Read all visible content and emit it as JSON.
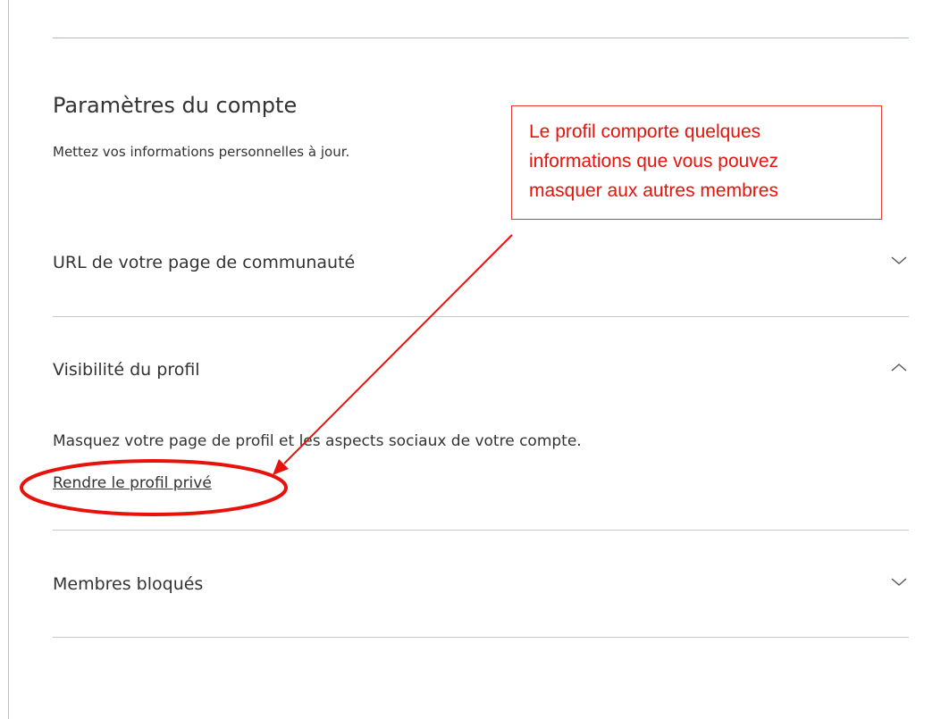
{
  "account_settings": {
    "title": "Paramètres du compte",
    "subtitle": "Mettez vos informations personnelles à jour."
  },
  "sections": {
    "community_url": {
      "label": "URL de votre page de communauté",
      "expanded": false,
      "chevron_icon": "chevron-down-icon"
    },
    "profile_visibility": {
      "label": "Visibilité du profil",
      "expanded": true,
      "chevron_icon": "chevron-up-icon",
      "description": "Masquez votre page de profil et les aspects sociaux de votre compte.",
      "action_link": "Rendre le profil privé"
    },
    "blocked_members": {
      "label": "Membres bloqués",
      "expanded": false,
      "chevron_icon": "chevron-down-icon"
    }
  },
  "annotation": {
    "callout_lines": [
      "Le profil comporte quelques",
      "informations que vous pouvez",
      "masquer aux autres membres"
    ],
    "color": "#e8120c"
  },
  "colors": {
    "text": "#333333",
    "top_rule": "#aebdcc",
    "divider": "#c8c8c8"
  }
}
